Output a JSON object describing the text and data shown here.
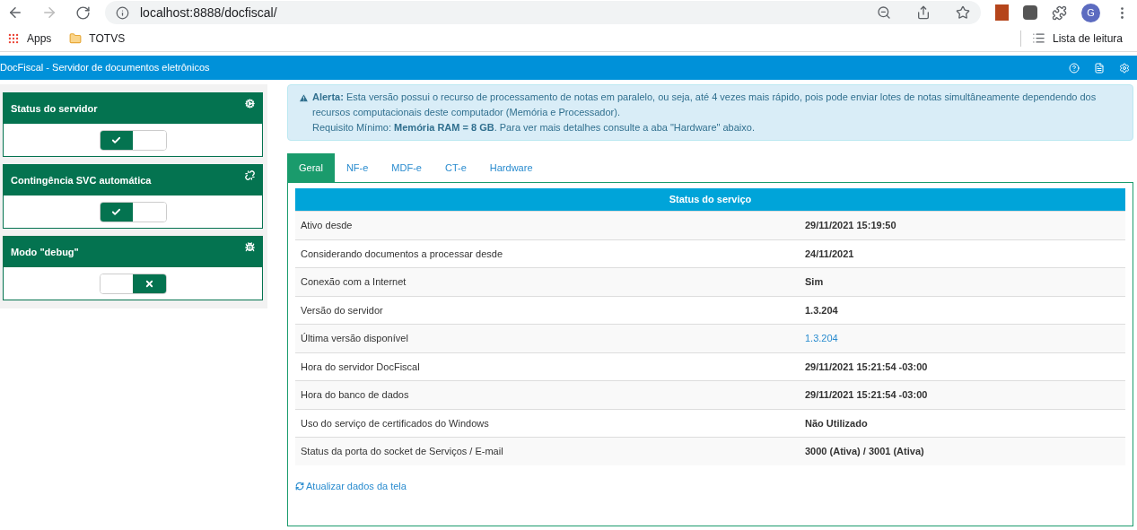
{
  "browser": {
    "url": "localhost:8888/docfiscal/",
    "bookmarks": [
      "Apps",
      "TOTVS"
    ],
    "reading_list": "Lista de leitura",
    "profile_initial": "G"
  },
  "app_bar": {
    "title": "DocFiscal - Servidor de documentos eletrônicos"
  },
  "sidebar": {
    "panels": [
      {
        "title": "Status do servidor",
        "on": true
      },
      {
        "title": "Contingência SVC automática",
        "on": true
      },
      {
        "title": "Modo \"debug\"",
        "on": false
      }
    ]
  },
  "alert": {
    "lines": [
      "**Alerta:** Esta versão possui o recurso de processamento de notas em paralelo, ou seja, até 4 vezes mais rápido, pois pode enviar lotes de notas simultâneamente dependendo dos recursos computacionais deste computador (Memória e Processador).",
      "Requisito Mínimo: **Memória RAM = 8 GB**. Para ver mais detalhes consulte a aba \"Hardware\" abaixo."
    ]
  },
  "tabs": [
    {
      "label": "Geral",
      "selected": true
    },
    {
      "label": "NF-e",
      "selected": false
    },
    {
      "label": "MDF-e",
      "selected": false
    },
    {
      "label": "CT-e",
      "selected": false
    },
    {
      "label": "Hardware",
      "selected": false
    }
  ],
  "table": {
    "title": "Status do serviço",
    "rows": [
      {
        "label": "Ativo desde",
        "value": "29/11/2021 15:19:50",
        "kind": "text"
      },
      {
        "label": "Considerando documentos a processar desde",
        "value": "24/11/2021",
        "kind": "text"
      },
      {
        "label": "Conexão com a Internet",
        "value": "Sim",
        "kind": "text"
      },
      {
        "label": "Versão do servidor",
        "value": "1.3.204",
        "kind": "text"
      },
      {
        "label": "Última versão disponível",
        "value": "1.3.204",
        "kind": "link"
      },
      {
        "label": "Hora do servidor DocFiscal",
        "value": "29/11/2021 15:21:54 -03:00",
        "kind": "text"
      },
      {
        "label": "Hora do banco de dados",
        "value": "29/11/2021 15:21:54 -03:00",
        "kind": "text"
      },
      {
        "label": "Uso do serviço de certificados do Windows",
        "value": "Não Utilizado",
        "kind": "text"
      },
      {
        "label": "Status da porta do socket de Serviços / E-mail",
        "value": "3000 (Ativa) / 3001 (Ativa)",
        "kind": "text"
      }
    ]
  },
  "refresh_link": "Atualizar dados da tela"
}
